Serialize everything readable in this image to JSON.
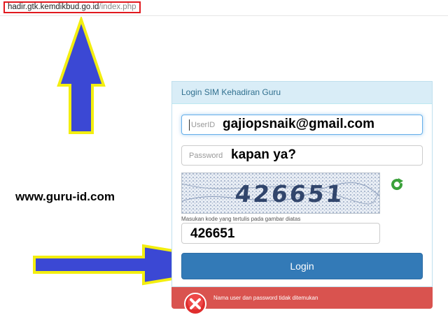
{
  "browser": {
    "url_host": "hadir.gtk.kemdikbud.go.id",
    "url_path": "/index.php"
  },
  "watermark": "www.guru-id.com",
  "login": {
    "panel_title": "Login SIM Kehadiran Guru",
    "userid_placeholder": "UserID",
    "userid_value": "gajiopsnaik@gmail.com",
    "password_placeholder": "Password",
    "password_value": "kapan ya?",
    "captcha_text": "426651",
    "captcha_hint": "Masukan kode yang tertulis pada gambar diatas",
    "captcha_value": "426651",
    "login_button": "Login",
    "error_message": "Nama user dan password tidak ditemukan"
  },
  "colors": {
    "panel_header_bg": "#d9edf7",
    "button_primary": "#337ab7",
    "alert_danger": "#d9534f",
    "annotation_arrow_fill": "#3b48d4",
    "annotation_arrow_border": "#f3ee10",
    "url_highlight": "#e1191f"
  },
  "icons": [
    "refresh-icon",
    "error-x-icon",
    "arrow-up-annotation",
    "arrow-right-annotation"
  ]
}
